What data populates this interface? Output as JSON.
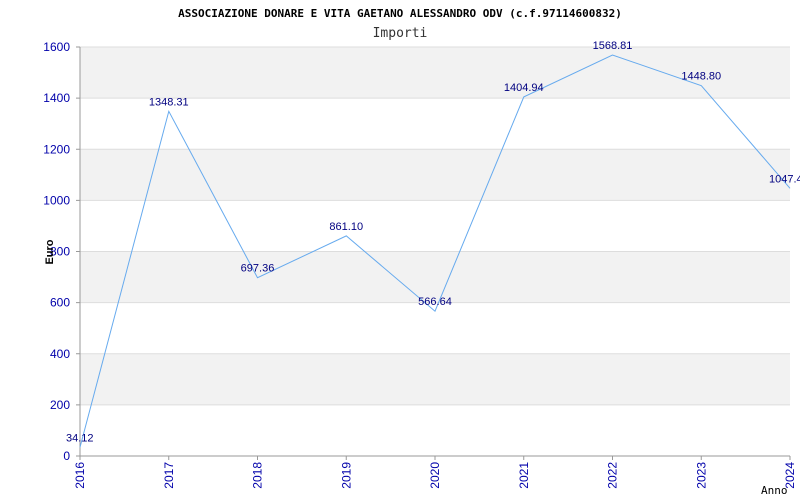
{
  "chart_data": {
    "type": "line",
    "title": "ASSOCIAZIONE DONARE E VITA GAETANO ALESSANDRO ODV (c.f.97114600832)",
    "subtitle": "Importi",
    "xlabel": "Anno",
    "ylabel": "Euro",
    "categories": [
      "2016",
      "2017",
      "2018",
      "2019",
      "2020",
      "2021",
      "2022",
      "2023",
      "2024"
    ],
    "values": [
      34.12,
      1348.31,
      697.36,
      861.1,
      566.64,
      1404.94,
      1568.81,
      1448.8,
      1047.4
    ],
    "data_labels": [
      "34.12",
      "1348.31",
      "697.36",
      "861.10",
      "566.64",
      "1404.94",
      "1568.81",
      "1448.80",
      "1047.4"
    ],
    "yticks": [
      "0",
      "200",
      "400",
      "600",
      "800",
      "1000",
      "1200",
      "1400",
      "1600"
    ],
    "ylim": [
      0,
      1600
    ],
    "grid": true,
    "colors": {
      "line": "#66aaee",
      "band": "#f2f2f2",
      "tick_text": "#0000aa",
      "label_text": "#000080"
    }
  }
}
